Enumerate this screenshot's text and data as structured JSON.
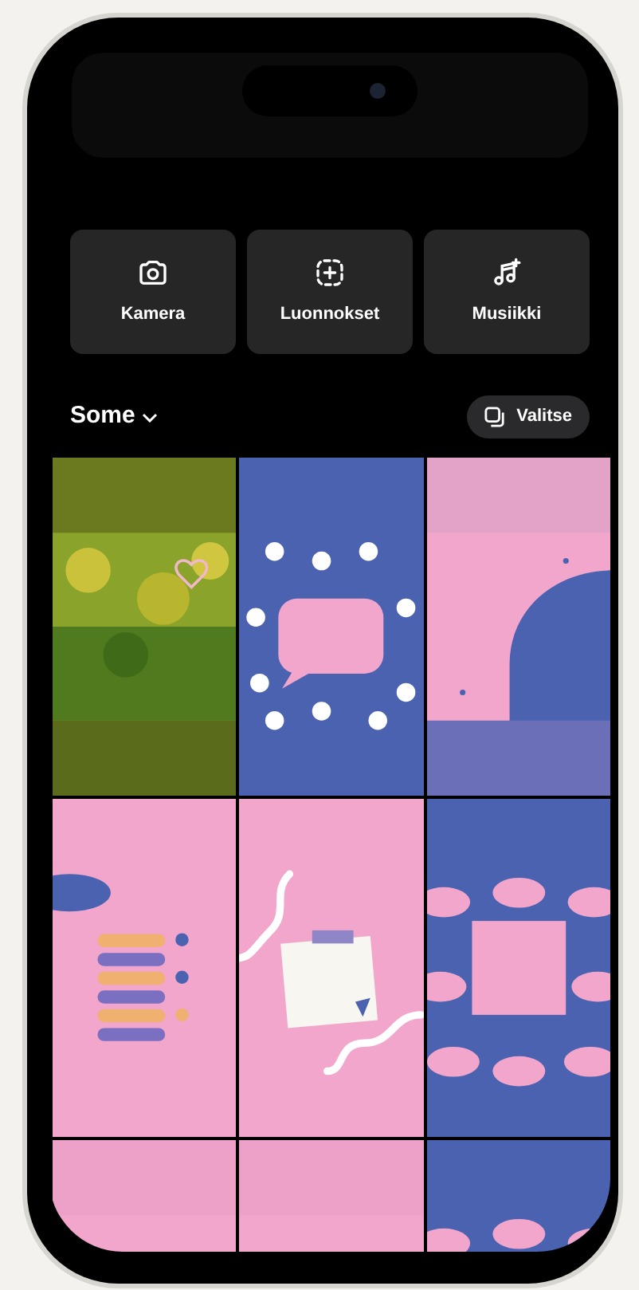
{
  "actions": [
    {
      "label": "Kamera",
      "kind": "camera"
    },
    {
      "label": "Luonnokset",
      "kind": "drafts"
    },
    {
      "label": "Musiikki",
      "kind": "music"
    }
  ],
  "album": {
    "title": "Some"
  },
  "select_button": {
    "label": "Valitse"
  }
}
